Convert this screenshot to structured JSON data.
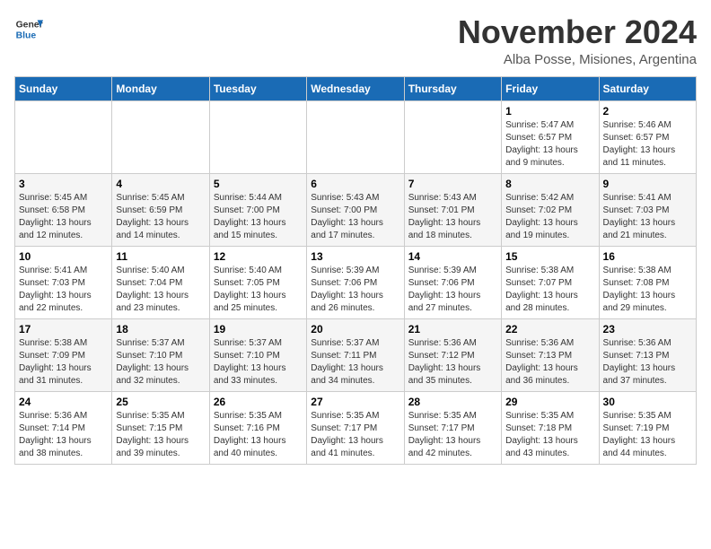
{
  "header": {
    "logo": {
      "general": "General",
      "blue": "Blue"
    },
    "title": "November 2024",
    "location": "Alba Posse, Misiones, Argentina"
  },
  "days_of_week": [
    "Sunday",
    "Monday",
    "Tuesday",
    "Wednesday",
    "Thursday",
    "Friday",
    "Saturday"
  ],
  "weeks": [
    [
      {
        "day": "",
        "info": ""
      },
      {
        "day": "",
        "info": ""
      },
      {
        "day": "",
        "info": ""
      },
      {
        "day": "",
        "info": ""
      },
      {
        "day": "",
        "info": ""
      },
      {
        "day": "1",
        "info": "Sunrise: 5:47 AM\nSunset: 6:57 PM\nDaylight: 13 hours\nand 9 minutes."
      },
      {
        "day": "2",
        "info": "Sunrise: 5:46 AM\nSunset: 6:57 PM\nDaylight: 13 hours\nand 11 minutes."
      }
    ],
    [
      {
        "day": "3",
        "info": "Sunrise: 5:45 AM\nSunset: 6:58 PM\nDaylight: 13 hours\nand 12 minutes."
      },
      {
        "day": "4",
        "info": "Sunrise: 5:45 AM\nSunset: 6:59 PM\nDaylight: 13 hours\nand 14 minutes."
      },
      {
        "day": "5",
        "info": "Sunrise: 5:44 AM\nSunset: 7:00 PM\nDaylight: 13 hours\nand 15 minutes."
      },
      {
        "day": "6",
        "info": "Sunrise: 5:43 AM\nSunset: 7:00 PM\nDaylight: 13 hours\nand 17 minutes."
      },
      {
        "day": "7",
        "info": "Sunrise: 5:43 AM\nSunset: 7:01 PM\nDaylight: 13 hours\nand 18 minutes."
      },
      {
        "day": "8",
        "info": "Sunrise: 5:42 AM\nSunset: 7:02 PM\nDaylight: 13 hours\nand 19 minutes."
      },
      {
        "day": "9",
        "info": "Sunrise: 5:41 AM\nSunset: 7:03 PM\nDaylight: 13 hours\nand 21 minutes."
      }
    ],
    [
      {
        "day": "10",
        "info": "Sunrise: 5:41 AM\nSunset: 7:03 PM\nDaylight: 13 hours\nand 22 minutes."
      },
      {
        "day": "11",
        "info": "Sunrise: 5:40 AM\nSunset: 7:04 PM\nDaylight: 13 hours\nand 23 minutes."
      },
      {
        "day": "12",
        "info": "Sunrise: 5:40 AM\nSunset: 7:05 PM\nDaylight: 13 hours\nand 25 minutes."
      },
      {
        "day": "13",
        "info": "Sunrise: 5:39 AM\nSunset: 7:06 PM\nDaylight: 13 hours\nand 26 minutes."
      },
      {
        "day": "14",
        "info": "Sunrise: 5:39 AM\nSunset: 7:06 PM\nDaylight: 13 hours\nand 27 minutes."
      },
      {
        "day": "15",
        "info": "Sunrise: 5:38 AM\nSunset: 7:07 PM\nDaylight: 13 hours\nand 28 minutes."
      },
      {
        "day": "16",
        "info": "Sunrise: 5:38 AM\nSunset: 7:08 PM\nDaylight: 13 hours\nand 29 minutes."
      }
    ],
    [
      {
        "day": "17",
        "info": "Sunrise: 5:38 AM\nSunset: 7:09 PM\nDaylight: 13 hours\nand 31 minutes."
      },
      {
        "day": "18",
        "info": "Sunrise: 5:37 AM\nSunset: 7:10 PM\nDaylight: 13 hours\nand 32 minutes."
      },
      {
        "day": "19",
        "info": "Sunrise: 5:37 AM\nSunset: 7:10 PM\nDaylight: 13 hours\nand 33 minutes."
      },
      {
        "day": "20",
        "info": "Sunrise: 5:37 AM\nSunset: 7:11 PM\nDaylight: 13 hours\nand 34 minutes."
      },
      {
        "day": "21",
        "info": "Sunrise: 5:36 AM\nSunset: 7:12 PM\nDaylight: 13 hours\nand 35 minutes."
      },
      {
        "day": "22",
        "info": "Sunrise: 5:36 AM\nSunset: 7:13 PM\nDaylight: 13 hours\nand 36 minutes."
      },
      {
        "day": "23",
        "info": "Sunrise: 5:36 AM\nSunset: 7:13 PM\nDaylight: 13 hours\nand 37 minutes."
      }
    ],
    [
      {
        "day": "24",
        "info": "Sunrise: 5:36 AM\nSunset: 7:14 PM\nDaylight: 13 hours\nand 38 minutes."
      },
      {
        "day": "25",
        "info": "Sunrise: 5:35 AM\nSunset: 7:15 PM\nDaylight: 13 hours\nand 39 minutes."
      },
      {
        "day": "26",
        "info": "Sunrise: 5:35 AM\nSunset: 7:16 PM\nDaylight: 13 hours\nand 40 minutes."
      },
      {
        "day": "27",
        "info": "Sunrise: 5:35 AM\nSunset: 7:17 PM\nDaylight: 13 hours\nand 41 minutes."
      },
      {
        "day": "28",
        "info": "Sunrise: 5:35 AM\nSunset: 7:17 PM\nDaylight: 13 hours\nand 42 minutes."
      },
      {
        "day": "29",
        "info": "Sunrise: 5:35 AM\nSunset: 7:18 PM\nDaylight: 13 hours\nand 43 minutes."
      },
      {
        "day": "30",
        "info": "Sunrise: 5:35 AM\nSunset: 7:19 PM\nDaylight: 13 hours\nand 44 minutes."
      }
    ]
  ]
}
